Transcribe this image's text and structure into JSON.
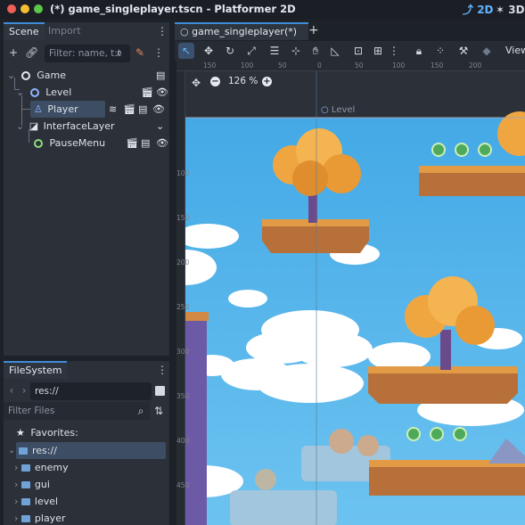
{
  "window": {
    "title": "(*) game_singleplayer.tscn - Platformer 2D",
    "mode_2d": "2D",
    "mode_3d": "3D"
  },
  "scene_dock": {
    "tabs": [
      "Scene",
      "Import"
    ],
    "filter_placeholder": "Filter: name, t:t",
    "tree": [
      {
        "label": "Game",
        "icon": "node-icon"
      },
      {
        "label": "Level",
        "icon": "node2d-icon"
      },
      {
        "label": "Player",
        "icon": "character-icon"
      },
      {
        "label": "InterfaceLayer",
        "icon": "canvas-layer-icon"
      },
      {
        "label": "PauseMenu",
        "icon": "control-icon"
      }
    ]
  },
  "filesystem_dock": {
    "tab": "FileSystem",
    "path": "res://",
    "filter_placeholder": "Filter Files",
    "favorites_label": "Favorites:",
    "root_label": "res://",
    "folders": [
      "enemy",
      "gui",
      "level",
      "player"
    ]
  },
  "editor": {
    "scene_tab": "game_singleplayer(*)",
    "add_tab": "+",
    "zoom": "126 %",
    "view_menu": "View",
    "level_label": "Level",
    "ruler_top": [
      "150",
      "100",
      "50",
      "0",
      "50",
      "100",
      "150",
      "200"
    ],
    "ruler_left": [
      "100",
      "150",
      "200",
      "250",
      "300",
      "350",
      "400",
      "450"
    ]
  },
  "colors": {
    "accent": "#3f8cd9",
    "sky": "#4fb2eb",
    "tree_foliage": "#f0a640",
    "island_dirt": "#b7703a"
  }
}
